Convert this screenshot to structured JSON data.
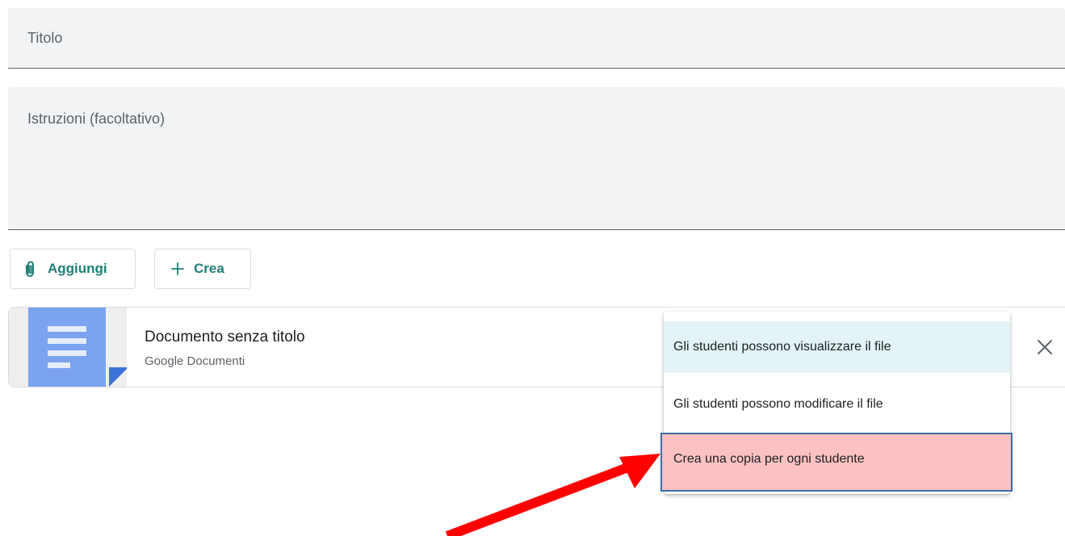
{
  "form": {
    "title_placeholder": "Titolo",
    "instructions_placeholder": "Istruzioni (facoltativo)"
  },
  "toolbar": {
    "add_label": "Aggiungi",
    "add_icon": "paperclip-icon",
    "create_label": "Crea",
    "create_icon": "plus-icon",
    "accent_color": "#1e7f77"
  },
  "attachment": {
    "title": "Documento senza titolo",
    "type": "Google Documenti",
    "icon": "google-docs-icon",
    "icon_color": "#4285f4",
    "remove_icon": "close-icon"
  },
  "sharing_menu": {
    "items": [
      {
        "label": "Gli studenti possono visualizzare il file",
        "state": "selected"
      },
      {
        "label": "Gli studenti possono modificare il file",
        "state": "normal"
      },
      {
        "label": "Crea una copia per ogni studente",
        "state": "highlighted"
      }
    ]
  },
  "annotation": {
    "arrow_icon": "red-arrow-icon",
    "arrow_color": "#ff0000"
  }
}
